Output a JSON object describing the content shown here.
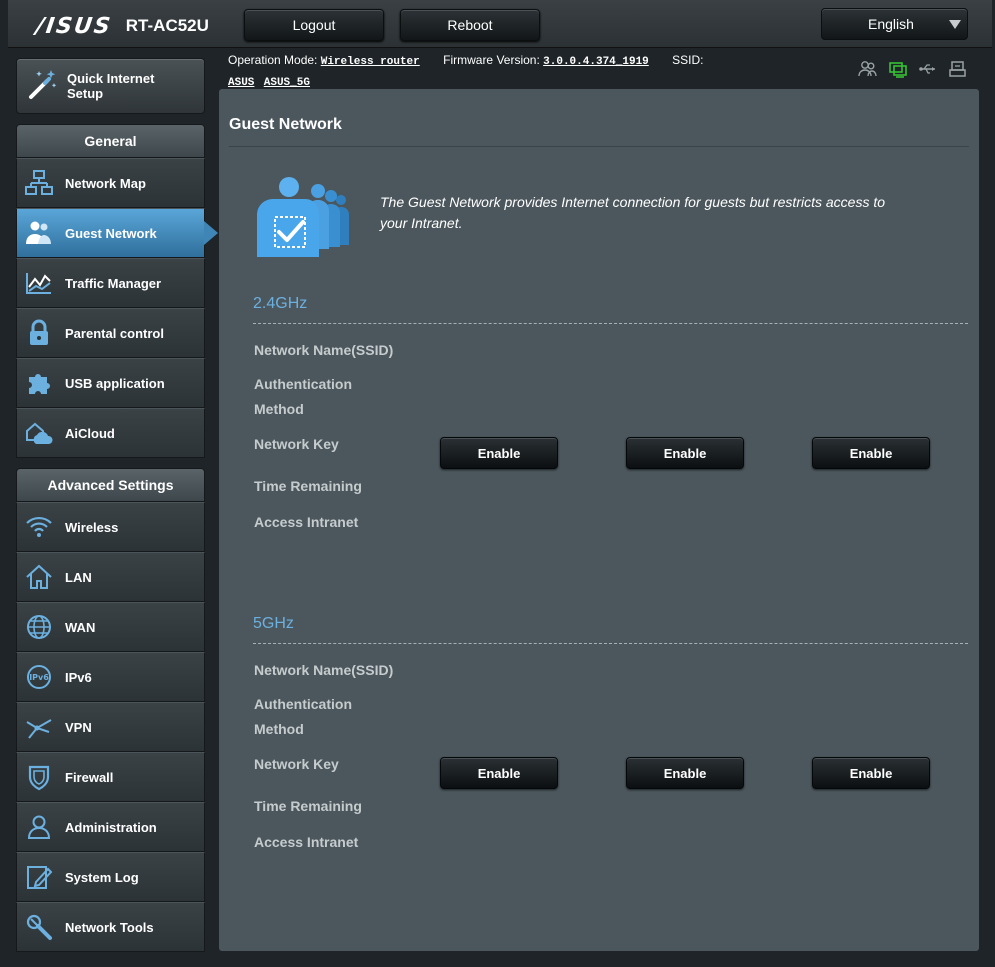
{
  "header": {
    "brand": "/ISUS",
    "model": "RT-AC52U",
    "logout_label": "Logout",
    "reboot_label": "Reboot",
    "language": "English"
  },
  "status": {
    "op_mode_label": "Operation Mode:",
    "op_mode_value": "Wireless router",
    "fw_label": "Firmware Version:",
    "fw_value": "3.0.0.4.374_1919",
    "ssid_label": "SSID:",
    "ssid_1": "ASUS",
    "ssid_2": "ASUS_5G"
  },
  "sidebar": {
    "quick_setup_line1": "Quick Internet",
    "quick_setup_line2": "Setup",
    "general_title": "General",
    "general_items": [
      {
        "label": "Network Map",
        "icon": "network-map-icon"
      },
      {
        "label": "Guest Network",
        "icon": "guest-network-icon"
      },
      {
        "label": "Traffic Manager",
        "icon": "traffic-manager-icon"
      },
      {
        "label": "Parental control",
        "icon": "lock-icon"
      },
      {
        "label": "USB application",
        "icon": "puzzle-icon"
      },
      {
        "label": "AiCloud",
        "icon": "cloud-icon"
      }
    ],
    "advanced_title": "Advanced Settings",
    "advanced_items": [
      {
        "label": "Wireless",
        "icon": "wifi-icon"
      },
      {
        "label": "LAN",
        "icon": "home-icon"
      },
      {
        "label": "WAN",
        "icon": "globe-icon"
      },
      {
        "label": "IPv6",
        "icon": "ipv6-icon"
      },
      {
        "label": "VPN",
        "icon": "vpn-icon"
      },
      {
        "label": "Firewall",
        "icon": "shield-icon"
      },
      {
        "label": "Administration",
        "icon": "user-icon"
      },
      {
        "label": "System Log",
        "icon": "system-log-icon"
      },
      {
        "label": "Network Tools",
        "icon": "tools-icon"
      }
    ]
  },
  "main": {
    "title": "Guest Network",
    "intro": "The Guest Network provides Internet connection for guests but restricts access to your Intranet.",
    "bands": [
      {
        "name": "2.4GHz",
        "fields": [
          "Network Name(SSID)",
          "Authentication Method",
          "Network Key",
          "Time Remaining",
          "Access Intranet"
        ],
        "buttons": [
          "Enable",
          "Enable",
          "Enable"
        ]
      },
      {
        "name": "5GHz",
        "fields": [
          "Network Name(SSID)",
          "Authentication Method",
          "Network Key",
          "Time Remaining",
          "Access Intranet"
        ],
        "buttons": [
          "Enable",
          "Enable",
          "Enable"
        ]
      }
    ]
  },
  "colors": {
    "accent": "#6cb0e0",
    "active_menu": "#3f86b7",
    "panel": "#4c575d"
  }
}
